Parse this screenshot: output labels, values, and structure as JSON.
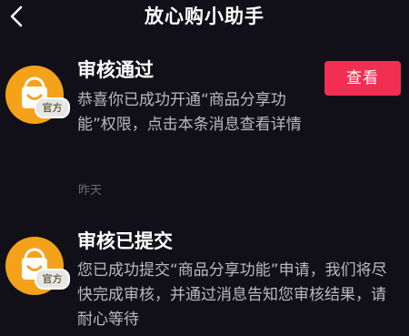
{
  "header": {
    "title": "放心购小助手"
  },
  "messages": [
    {
      "title": "审核通过",
      "body": "恭喜你已成功开通“商品分享功能”权限，点击本条消息查看详情",
      "time": "昨天",
      "badge": "官方",
      "action_label": "查看"
    },
    {
      "title": "审核已提交",
      "body": "您已成功提交“商品分享功能”申请，我们将尽快完成审核，并通过消息告知您审核结果，请耐心等待",
      "badge": "官方"
    }
  ],
  "colors": {
    "background": "#111018",
    "avatar": "#f5a21b",
    "accent_button": "#f22f52",
    "secondary_text": "#b9b9be"
  },
  "icons": {
    "back": "chevron-left-icon",
    "avatar": "shopping-bag-smile-icon"
  }
}
